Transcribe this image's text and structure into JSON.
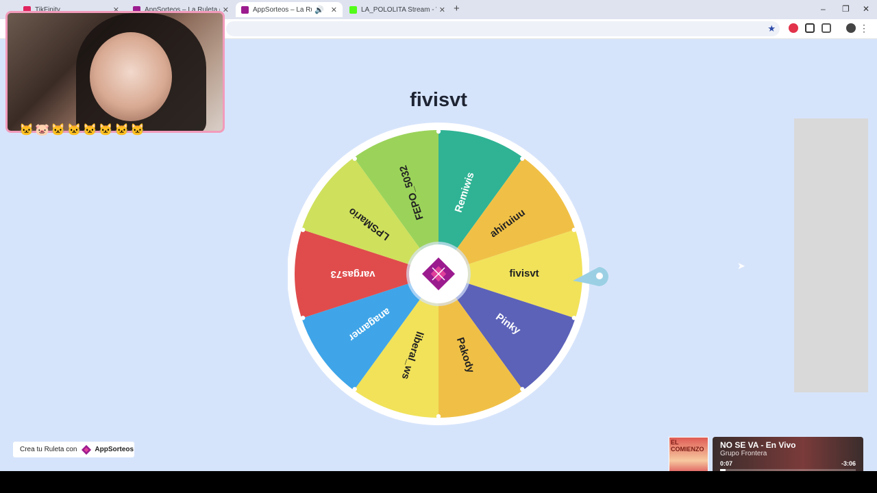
{
  "browser": {
    "tabs": [
      {
        "title": "TikFinity",
        "icon_color": "#e0245e",
        "active": false
      },
      {
        "title": "AppSorteos – La Ruleta de la Suerte",
        "icon_color": "#9b1b8f",
        "active": false
      },
      {
        "title": "AppSorteos – La Ruleta de la Suerte",
        "icon_color": "#9b1b8f",
        "active": true
      },
      {
        "title": "LA_POLOLITA Stream - Watch Live",
        "icon_color": "#53fc18",
        "active": false
      }
    ],
    "new_tab": "+",
    "window": {
      "minimize": "–",
      "restore": "❐",
      "close": "✕"
    },
    "bookmark_icon": "star-icon",
    "menu_icon": "⋮"
  },
  "wheel": {
    "winner": "fivisvt",
    "segments": [
      {
        "label": "fivisvt",
        "color": "#f1e25a"
      },
      {
        "label": "Pinky",
        "color": "#5c62b8"
      },
      {
        "label": "Pakody",
        "color": "#f0c046"
      },
      {
        "label": "liberal_ws",
        "color": "#f1e25a"
      },
      {
        "label": "anagamer",
        "color": "#3fa5e8"
      },
      {
        "label": "vargas73",
        "color": "#e04c4c"
      },
      {
        "label": "LPSMario",
        "color": "#cfe05c"
      },
      {
        "label": "FEPO_5032",
        "color": "#9bd35a"
      },
      {
        "label": "Remiwis",
        "color": "#2fb394"
      },
      {
        "label": "ahiruiuu",
        "color": "#f0c046"
      }
    ],
    "center_logo": "appsorteos-logo-icon"
  },
  "promo": {
    "text": "Crea tu Ruleta con",
    "brand": "AppSorteos"
  },
  "music": {
    "art_text": "EL COMIENZO",
    "song": "NO SE VA - En Vivo",
    "artist": "Grupo Frontera",
    "elapsed": "0:07",
    "remaining": "-3:06",
    "progress": 0.04
  }
}
